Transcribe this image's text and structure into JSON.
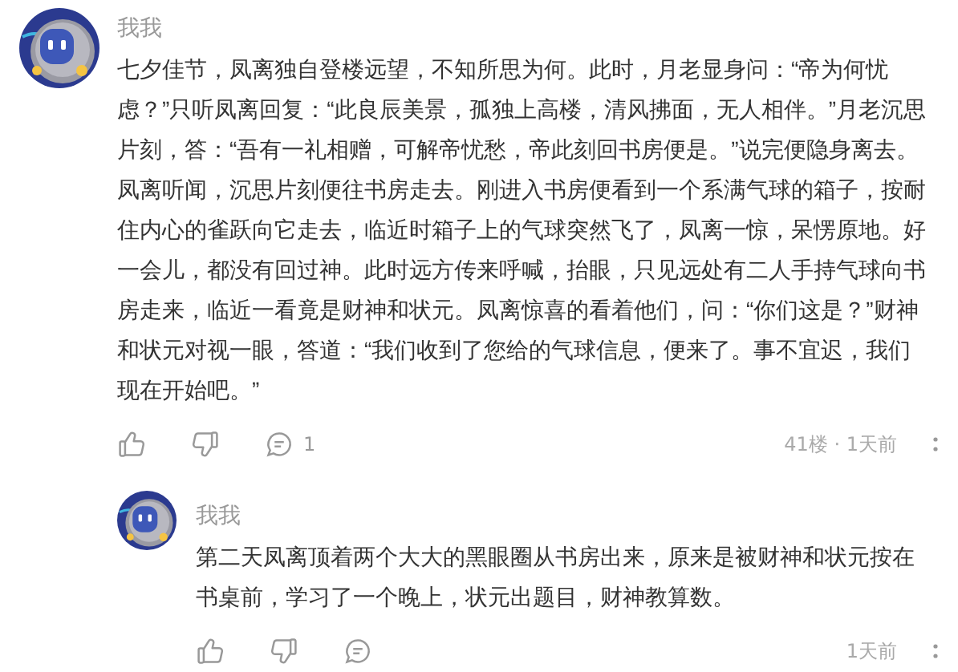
{
  "comments": [
    {
      "author": "我我",
      "text": "七夕佳节，凤离独自登楼远望，不知所思为何。此时，月老显身问：“帝为何忧虑？”只听凤离回复：“此良辰美景，孤独上高楼，清风拂面，无人相伴。”月老沉思片刻，答：“吾有一礼相赠，可解帝忧愁，帝此刻回书房便是。”说完便隐身离去。凤离听闻，沉思片刻便往书房走去。刚进入书房便看到一个系满气球的箱子，按耐住内心的雀跃向它走去，临近时箱子上的气球突然飞了，凤离一惊，呆愣原地。好一会儿，都没有回过神。此时远方传来呼喊，抬眼，只见远处有二人手持气球向书房走来，临近一看竟是财神和状元。凤离惊喜的看着他们，问：“你们这是？”财神和状元对视一眼，答道：“我们收到了您给的气球信息，便来了。事不宜迟，我们现在开始吧。”",
      "reply_count": "1",
      "meta": "41楼 · 1天前",
      "replies": [
        {
          "author": "我我",
          "text": "第二天凤离顶着两个大大的黑眼圈从书房出来，原来是被财神和状元按在书桌前，学习了一个晚上，状元出题目，财神教算数。",
          "meta": "1天前"
        }
      ]
    }
  ]
}
